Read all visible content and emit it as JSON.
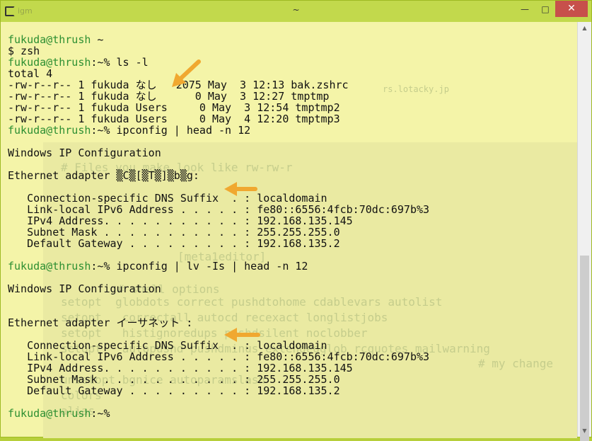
{
  "window": {
    "title": "~",
    "ghost_title": "igm",
    "controls": {
      "minimize": "—",
      "maximize": "□",
      "close": "✕"
    }
  },
  "terminal": {
    "lines": [
      {
        "user": "fukuda@thrush",
        "rest": " ~"
      },
      {
        "user": "",
        "rest": "$ zsh"
      },
      {
        "user": "fukuda@thrush",
        "rest": ":~% ls -l"
      },
      {
        "user": "",
        "rest": "total 4"
      },
      {
        "user": "",
        "rest": "-rw-r--r-- 1 fukuda なし   2075 May  3 12:13 bak.zshrc"
      },
      {
        "user": "",
        "rest": "-rw-r--r-- 1 fukuda なし      0 May  3 12:27 tmptmp"
      },
      {
        "user": "",
        "rest": "-rw-r--r-- 1 fukuda Users     0 May  3 12:54 tmptmp2"
      },
      {
        "user": "",
        "rest": "-rw-r--r-- 1 fukuda Users     0 May  4 12:20 tmptmp3"
      },
      {
        "user": "fukuda@thrush",
        "rest": ":~% ipconfig | head -n 12"
      },
      {
        "user": "",
        "rest": ""
      },
      {
        "user": "",
        "rest": "Windows IP Configuration"
      },
      {
        "user": "",
        "rest": ""
      },
      {
        "user": "",
        "rest": "Ethernet adapter ▒C▒[▒T▒]▒b▒g:"
      },
      {
        "user": "",
        "rest": ""
      },
      {
        "user": "",
        "rest": "   Connection-specific DNS Suffix  . : localdomain"
      },
      {
        "user": "",
        "rest": "   Link-local IPv6 Address . . . . . : fe80::6556:4fcb:70dc:697b%3"
      },
      {
        "user": "",
        "rest": "   IPv4 Address. . . . . . . . . . . : 192.168.135.145"
      },
      {
        "user": "",
        "rest": "   Subnet Mask . . . . . . . . . . . : 255.255.255.0"
      },
      {
        "user": "",
        "rest": "   Default Gateway . . . . . . . . . : 192.168.135.2"
      },
      {
        "user": "",
        "rest": ""
      },
      {
        "user": "fukuda@thrush",
        "rest": ":~% ipconfig | lv -Is | head -n 12"
      },
      {
        "user": "",
        "rest": ""
      },
      {
        "user": "",
        "rest": "Windows IP Configuration"
      },
      {
        "user": "",
        "rest": ""
      },
      {
        "user": "",
        "rest": ""
      },
      {
        "user": "",
        "rest": "Ethernet adapter イーサネット :"
      },
      {
        "user": "",
        "rest": ""
      },
      {
        "user": "",
        "rest": "   Connection-specific DNS Suffix  . : localdomain"
      },
      {
        "user": "",
        "rest": "   Link-local IPv6 Address . . . . . : fe80::6556:4fcb:70dc:697b%3"
      },
      {
        "user": "",
        "rest": "   IPv4 Address. . . . . . . . . . . : 192.168.135.145"
      },
      {
        "user": "",
        "rest": "   Subnet Mask . . . . . . . . . . . : 255.255.255.0"
      },
      {
        "user": "",
        "rest": "   Default Gateway . . . . . . . . . : 192.168.135.2"
      },
      {
        "user": "",
        "rest": ""
      },
      {
        "user": "fukuda@thrush",
        "rest": ":~%"
      }
    ]
  },
  "background_ghost": [
    "# Files you make look like rw-rw-r",
    "rs.lotacky.jp",
    "[meta1editor]",
    "# shell options",
    "setopt  globdots correct pushdtohome cdablevars autolist",
    "setopt   correctall autocd recexact longlistjobs",
    "setopt   histignoredups pushdsilent noclobber",
    "setopt   autopushd pushdminus extendedglob rcquotes mailwarning",
    "# my change",
    "unsetopt bgnice autoparamslash",
    "colors",
    "alias"
  ],
  "colors": {
    "prompt_user": "#2d8f32",
    "annotation_arrow": "#f0a830",
    "close_button": "#c7504b",
    "titlebar": "#c2d94c"
  },
  "icons": {
    "app": "terminal-app-icon",
    "arrow": "annotation-arrow-icon"
  }
}
